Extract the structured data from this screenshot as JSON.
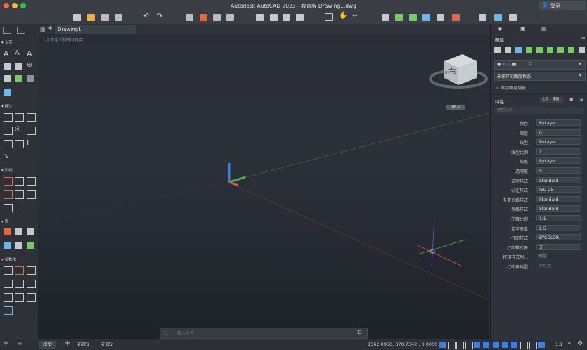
{
  "app": {
    "title": "Autodesk AutoCAD 2023 - 教育版   Drawing1.dwg",
    "user_label": "登录"
  },
  "tabs": {
    "drawing_tab": "Drawing1"
  },
  "viewport": {
    "view_label": "[-][自定义视图][真实]",
    "cube_face": "右",
    "cube_face2": "前",
    "wcs_label": "WCS"
  },
  "palette": {
    "sections": [
      "文字",
      "标注",
      "引线",
      "表",
      "参数化"
    ]
  },
  "right_panel": {
    "layers_title": "图层",
    "layer_current": "0",
    "layer_state": "未保存的图层状态",
    "layer_list_link": "显示图层列表",
    "props_title": "特性",
    "props_toggle": [
      "全部",
      "按图"
    ],
    "model_space": "模型空间",
    "properties": [
      {
        "label": "颜色",
        "value": "ByLayer"
      },
      {
        "label": "图层",
        "value": "0"
      },
      {
        "label": "线型",
        "value": "ByLayer"
      },
      {
        "label": "线型比例",
        "value": "1"
      },
      {
        "label": "线宽",
        "value": "ByLayer"
      },
      {
        "label": "透明度",
        "value": "0"
      },
      {
        "label": "文字样式",
        "value": "Standard"
      },
      {
        "label": "标注样式",
        "value": "ISO-25"
      },
      {
        "label": "多重引线样式",
        "value": "Standard"
      },
      {
        "label": "表格样式",
        "value": "Standard"
      },
      {
        "label": "注释比例",
        "value": "1:1"
      },
      {
        "label": "文字高度",
        "value": "2.5"
      },
      {
        "label": "打印样式",
        "value": "BYCOLOR"
      },
      {
        "label": "打印样式表",
        "value": "无"
      },
      {
        "label": "打印样式附...",
        "value": "模型"
      },
      {
        "label": "打印表类型",
        "value": "不可用"
      }
    ]
  },
  "command": {
    "placeholder": "输入命令"
  },
  "status": {
    "tabs": [
      "模型",
      "布局1",
      "布局2"
    ],
    "coords": "1562.0950, 370.7342 , 0.0000",
    "scale": "1:1"
  },
  "colors": {
    "accent": "#3d7fd9",
    "bg": "#2b2f37"
  }
}
